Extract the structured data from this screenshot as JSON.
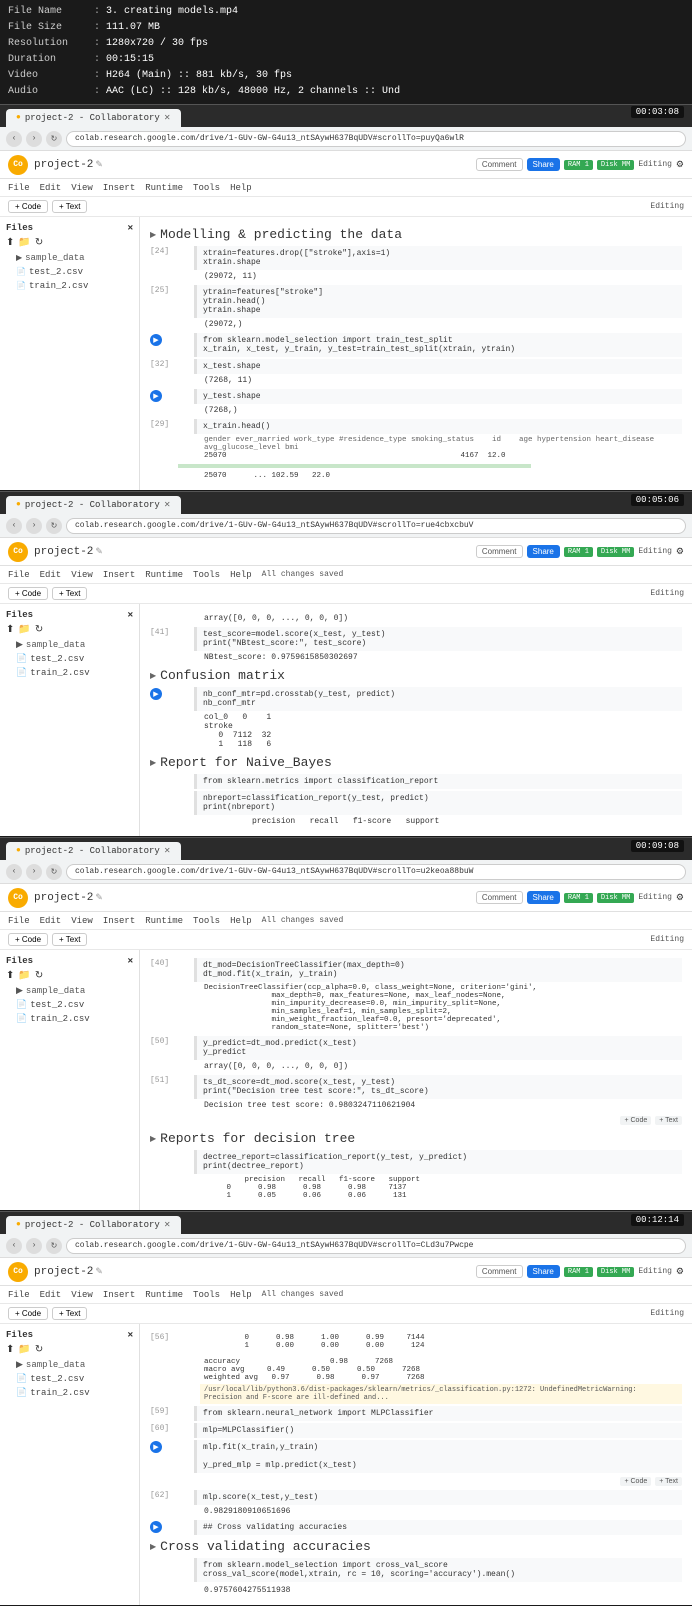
{
  "file_info": {
    "name_label": "File Name",
    "name_value": "3. creating models.mp4",
    "size_label": "File Size",
    "size_value": "111.07 MB",
    "resolution_label": "Resolution",
    "resolution_value": "1280x720 / 30 fps",
    "duration_label": "Duration",
    "duration_value": "00:15:15",
    "video_label": "Video",
    "video_value": "H264 (Main) :: 881 kb/s, 30 fps",
    "audio_label": "Audio",
    "audio_value": "AAC (LC) :: 128 kb/s, 48000 Hz, 2 channels :: Und"
  },
  "sections": [
    {
      "id": "section1",
      "timestamp": "00:03:08",
      "url": "colab.research.google.com/drive/1-GUv-GW-G4u13_ntSAywH637BqUDV#scrollTo=puyQa6wlR",
      "tab_label": "project-2 - Collaboratory",
      "project_name": "project-2",
      "saved_status": "",
      "section_title": "Modelling & predicting the data",
      "cells": [
        {
          "number": "[24]",
          "type": "code",
          "content": "xtrain=features.drop([\"stroke\"],axis=1)\n     xtrain.shape",
          "output": "(29072, 11)"
        },
        {
          "number": "[25]",
          "type": "code",
          "content": "ytrain=features[\"stroke\"]\n     ytrain.head()\n     ytrain.shape",
          "output": "(29072,)"
        },
        {
          "number": "",
          "type": "run",
          "content": "from sklearn.model_selection import train_test_split\n     x_train, x_test, y_train, y_test=train_test_split(xtrain, ytrain)",
          "output": ""
        },
        {
          "number": "[32]",
          "type": "code",
          "content": "x_test.shape",
          "output": "(7268, 11)"
        },
        {
          "number": "",
          "type": "run",
          "content": "y_test.shape",
          "output": "(7268,)"
        },
        {
          "number": "[29]",
          "type": "code",
          "content": "x_train.head()",
          "output": "     gender  ever_married  work_type  #residence_type  smoking_status     id   age  hypertension  heart_disease  avg_glucose_level  bmi\n25070                                                                   4167  12.0"
        }
      ],
      "table_footer": "25070    ... 22.0"
    },
    {
      "id": "section2",
      "timestamp": "00:05:06",
      "url": "colab.research.google.com/drive/1-GUv-GW-G4u13_ntSAywH637BqUDV#scrollTo=rue4cbxcbuV",
      "tab_label": "project-2 - Collaboratory",
      "project_name": "project-2",
      "saved_status": "All changes saved",
      "section_title": "Confusion matrix",
      "cells": [
        {
          "number": "",
          "type": "output",
          "content": "array([0, 0, 0, ..., 0, 0, 0])",
          "output": ""
        },
        {
          "number": "[41]",
          "type": "code",
          "content": "test_score=model.score(x_test, y_test)\n     print(\"NBtest_score:\", test_score)",
          "output": "NBtest_score: 0.9759615850302697"
        },
        {
          "number": "",
          "type": "run",
          "content": "nb_conf_mtr=pd.crosstab(y_test, predict)\n     nb_conf_mtr",
          "output": "col_0   0   1\nstroke\n   0   7112  32\n   1    118   6"
        },
        {
          "number": "",
          "type": "section",
          "content": "Report for Naive_Bayes",
          "output": ""
        },
        {
          "number": "",
          "type": "code",
          "content": "from sklearn.metrics import classification_report",
          "output": ""
        },
        {
          "number": "",
          "type": "code",
          "content": "nbreport=classification_report(y_test, predict)\n     print(nbreport)",
          "output": "          precision  recall  f1-score  support"
        }
      ]
    },
    {
      "id": "section3",
      "timestamp": "00:09:08",
      "url": "colab.research.google.com/drive/1-GUv-GW-G4u13_ntSAywH637BqUDV#scrollTo=u2keoa88buW",
      "tab_label": "project-2 - Collaboratory",
      "project_name": "project-2",
      "saved_status": "All changes saved",
      "section_title": "Reports for decision tree",
      "cells": [
        {
          "number": "[40]",
          "type": "code",
          "content": "dt_mod=DecisionTreeClassifier(max_depth=0)\n     dt_mod.fit(x_train, y_train)",
          "output": "DecisionTreeClassifier(ccp_alpha=0.0, class_weight=None, criterion='gini',\n                       max_depth=0, max_features=None, max_leaf_nodes=None,\n                       min_impurity_decrease=0.0, min_impurity_split=None,\n                       min_samples_leaf=1, min_samples_split=2,\n                       min_weight_fraction_leaf=0.0, presort='deprecated',\n                       random_state=None, splitter='best')"
        },
        {
          "number": "[50]",
          "type": "code",
          "content": "y_predict=dt_mod.predict(x_test)\n     y_predict",
          "output": "array([0, 0, 0, ..., 0, 0, 0])"
        },
        {
          "number": "[51]",
          "type": "code",
          "content": "ts_dt_score=dt_mod.score(x_test, y_test)\n     print(\"Decision tree test score:\", ts_dt_score)",
          "output": "Decision tree test score: 0.9803247110621904"
        },
        {
          "number": "",
          "type": "section",
          "content": "Reports for decision tree",
          "output": ""
        },
        {
          "number": "",
          "type": "code",
          "content": "dectree_report=classification_report(y_test, y_predict)\n     print(dectree_report)",
          "output": "          precision  recall  f1-score  support\n     0       0.98      0.98      0.98    7137\n     1       0.05      0.06      0.06     131"
        }
      ]
    },
    {
      "id": "section4",
      "timestamp": "00:12:14",
      "url": "colab.research.google.com/drive/1-GUv-GW-G4u13_ntSAywH637BqUDV#scrollTo=CLd3u7Pwcpe",
      "tab_label": "project-2 - Collaboratory",
      "project_name": "project-2",
      "saved_status": "All changes saved",
      "section_title": "Cross validating accuracies",
      "cells": [
        {
          "number": "[56]",
          "type": "code",
          "content": "            0      0.98      1.00      0.99      7144\n            1      0.00      0.00      0.00       124\n\naccuracy                        0.98      7268\nmacro avg    0.49      0.50      0.50      7268\nweighted avg 0.97      0.98      0.97      7268",
          "output": "/usr/local/lib/python3.6/dist-packages/sklearn/metrics/_classification.py:1272: UndefinedMetricWarning: Precision and F-score are ill-defined..."
        },
        {
          "number": "[59]",
          "type": "code",
          "content": "from sklearn.neural_network import MLPClassifier",
          "output": ""
        },
        {
          "number": "[60]",
          "type": "code",
          "content": "mlp=MLPClassifier()",
          "output": ""
        },
        {
          "number": "",
          "type": "run",
          "content": "mlp.fit(x_train,y_train)\n\n     y_pred_mlp = mlp.predict(x_test)",
          "output": ""
        },
        {
          "number": "[62]",
          "type": "code",
          "content": "mlp.score(x_test,y_test)",
          "output": "0.9829180910651696"
        },
        {
          "number": "",
          "type": "run",
          "content": "## Cross validating accuracies",
          "output": ""
        },
        {
          "number": "",
          "type": "code",
          "content": "from sklearn.model_selection import cross_val_score\n     cross_val_score(model,xtrain, rc = 10, scoring='accuracy').mean()",
          "output": ""
        },
        {
          "number": "",
          "type": "output",
          "content": "0.9757604275511938",
          "output": ""
        }
      ]
    }
  ],
  "sidebar": {
    "title": "Files",
    "items": [
      {
        "name": "sample_data",
        "type": "folder"
      },
      {
        "name": "test_2.csv",
        "type": "file"
      },
      {
        "name": "train_2.csv",
        "type": "file"
      }
    ]
  },
  "colab_menu": [
    "File",
    "Edit",
    "View",
    "Insert",
    "Runtime",
    "Tools",
    "Help"
  ],
  "toolbar_buttons": [
    "+ Code",
    "+ Text"
  ],
  "right_buttons": [
    "Comment",
    "Share"
  ],
  "ram_label": "RAM",
  "disk_label": "Disk",
  "ram_value": "1",
  "disk_value": "MM",
  "editing_label": "Editing"
}
